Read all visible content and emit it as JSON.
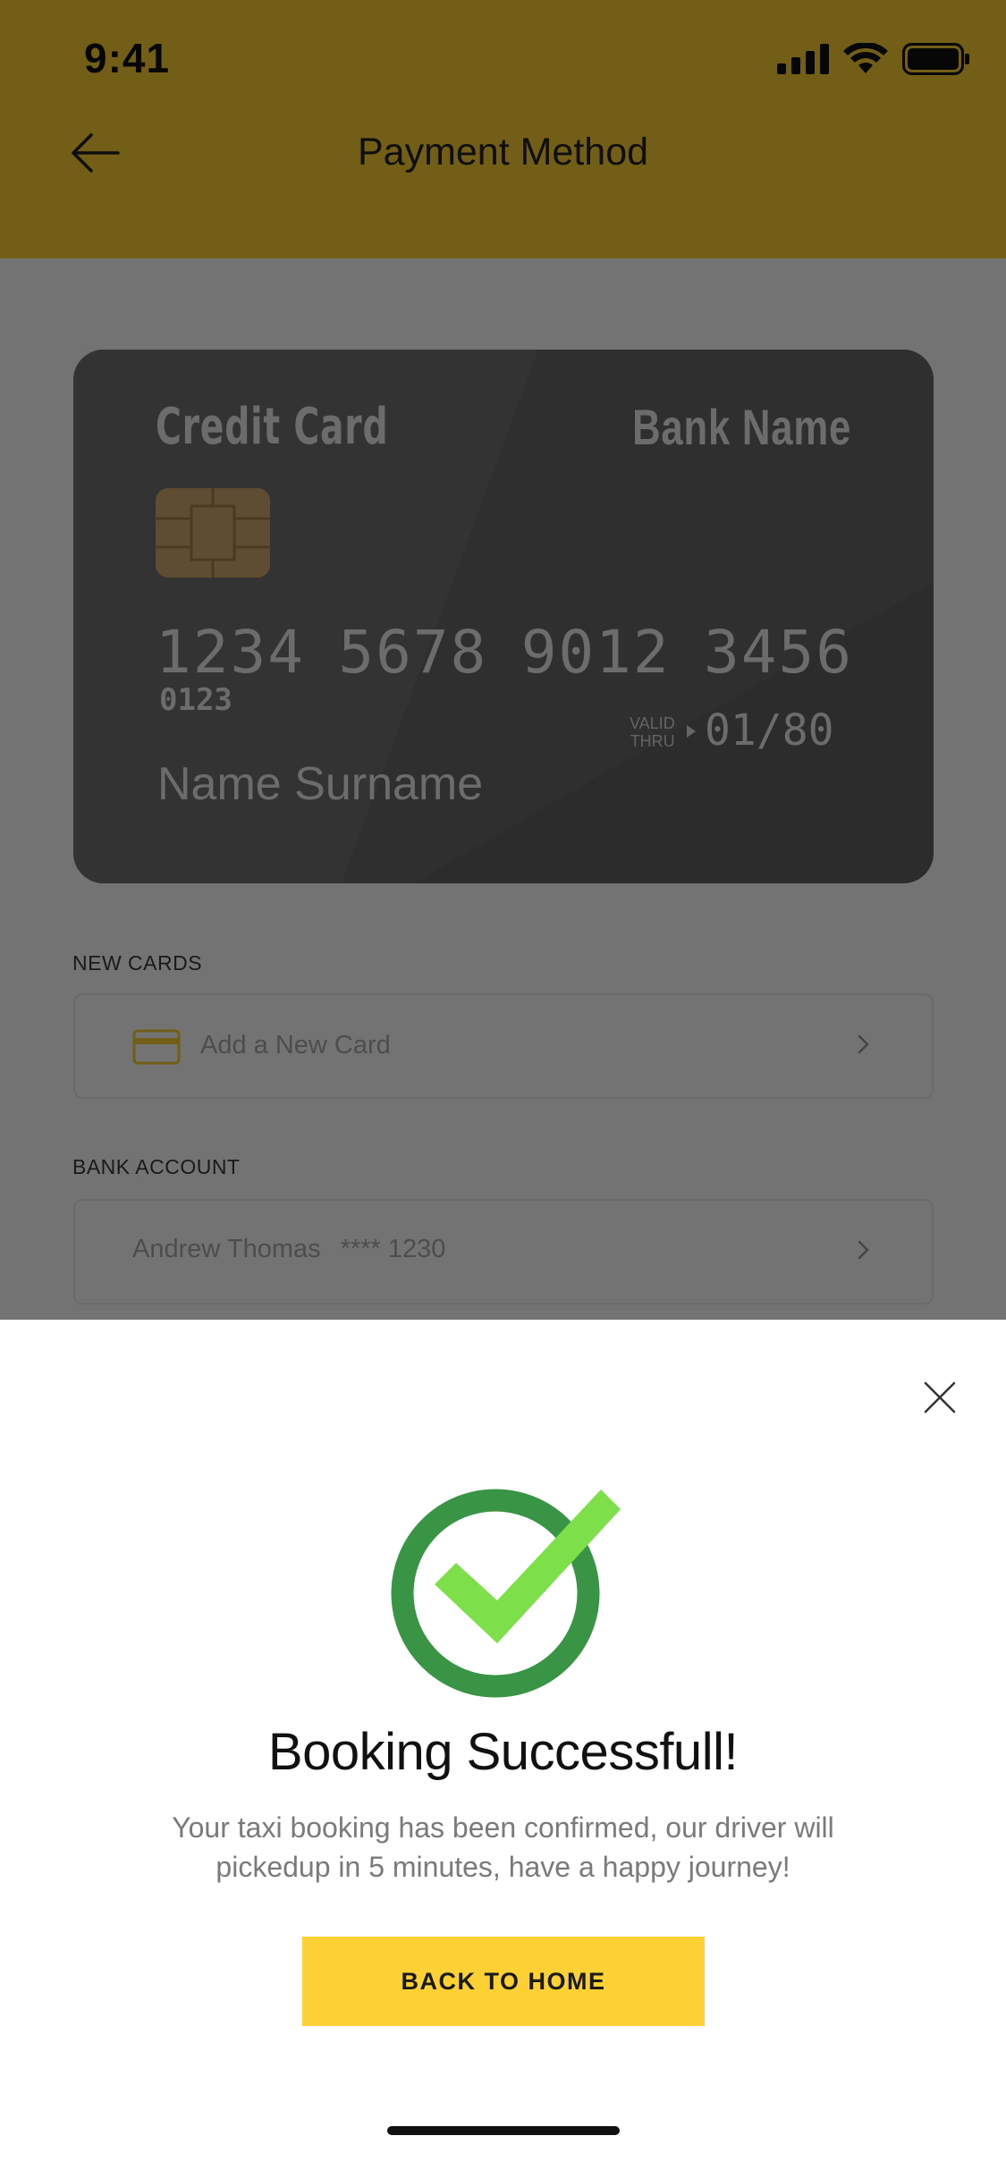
{
  "status_bar": {
    "time": "9:41"
  },
  "header": {
    "title": "Payment Method",
    "back_icon": "arrow-left-icon"
  },
  "card": {
    "type": "Credit Card",
    "bank": "Bank Name",
    "number_groups": [
      "1234",
      "5678",
      "9012",
      "3456"
    ],
    "small_number": "0123",
    "valid_thru_label_1": "VALID",
    "valid_thru_label_2": "THRU",
    "expiry": "01/80",
    "holder": "Name Surname"
  },
  "new_cards": {
    "label": "NEW CARDS",
    "item_label": "Add a New Card",
    "item_icon": "credit-card-icon"
  },
  "bank_account": {
    "label": "BANK ACCOUNT",
    "name": "Andrew Thomas",
    "masked": "**** 1230"
  },
  "modal": {
    "close_icon": "close-icon",
    "success_icon": "checkmark-circle-icon",
    "title": "Booking Successfull!",
    "message_line1": "Your taxi booking has been confirmed, our driver will",
    "message_line2": "pickedup in 5 minutes, have a happy journey!",
    "button_label": "BACK TO HOME"
  },
  "colors": {
    "accent": "#FDD034",
    "success_dark": "#3A9445",
    "success_light": "#7DE04A"
  }
}
